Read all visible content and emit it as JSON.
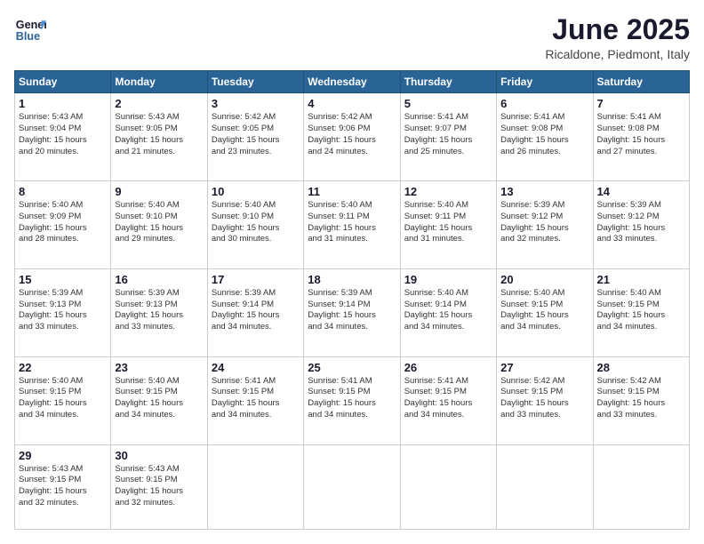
{
  "logo": {
    "line1": "General",
    "line2": "Blue"
  },
  "title": "June 2025",
  "location": "Ricaldone, Piedmont, Italy",
  "days_header": [
    "Sunday",
    "Monday",
    "Tuesday",
    "Wednesday",
    "Thursday",
    "Friday",
    "Saturday"
  ],
  "weeks": [
    [
      {
        "day": "1",
        "info": "Sunrise: 5:43 AM\nSunset: 9:04 PM\nDaylight: 15 hours\nand 20 minutes."
      },
      {
        "day": "2",
        "info": "Sunrise: 5:43 AM\nSunset: 9:05 PM\nDaylight: 15 hours\nand 21 minutes."
      },
      {
        "day": "3",
        "info": "Sunrise: 5:42 AM\nSunset: 9:05 PM\nDaylight: 15 hours\nand 23 minutes."
      },
      {
        "day": "4",
        "info": "Sunrise: 5:42 AM\nSunset: 9:06 PM\nDaylight: 15 hours\nand 24 minutes."
      },
      {
        "day": "5",
        "info": "Sunrise: 5:41 AM\nSunset: 9:07 PM\nDaylight: 15 hours\nand 25 minutes."
      },
      {
        "day": "6",
        "info": "Sunrise: 5:41 AM\nSunset: 9:08 PM\nDaylight: 15 hours\nand 26 minutes."
      },
      {
        "day": "7",
        "info": "Sunrise: 5:41 AM\nSunset: 9:08 PM\nDaylight: 15 hours\nand 27 minutes."
      }
    ],
    [
      {
        "day": "8",
        "info": "Sunrise: 5:40 AM\nSunset: 9:09 PM\nDaylight: 15 hours\nand 28 minutes."
      },
      {
        "day": "9",
        "info": "Sunrise: 5:40 AM\nSunset: 9:10 PM\nDaylight: 15 hours\nand 29 minutes."
      },
      {
        "day": "10",
        "info": "Sunrise: 5:40 AM\nSunset: 9:10 PM\nDaylight: 15 hours\nand 30 minutes."
      },
      {
        "day": "11",
        "info": "Sunrise: 5:40 AM\nSunset: 9:11 PM\nDaylight: 15 hours\nand 31 minutes."
      },
      {
        "day": "12",
        "info": "Sunrise: 5:40 AM\nSunset: 9:11 PM\nDaylight: 15 hours\nand 31 minutes."
      },
      {
        "day": "13",
        "info": "Sunrise: 5:39 AM\nSunset: 9:12 PM\nDaylight: 15 hours\nand 32 minutes."
      },
      {
        "day": "14",
        "info": "Sunrise: 5:39 AM\nSunset: 9:12 PM\nDaylight: 15 hours\nand 33 minutes."
      }
    ],
    [
      {
        "day": "15",
        "info": "Sunrise: 5:39 AM\nSunset: 9:13 PM\nDaylight: 15 hours\nand 33 minutes."
      },
      {
        "day": "16",
        "info": "Sunrise: 5:39 AM\nSunset: 9:13 PM\nDaylight: 15 hours\nand 33 minutes."
      },
      {
        "day": "17",
        "info": "Sunrise: 5:39 AM\nSunset: 9:14 PM\nDaylight: 15 hours\nand 34 minutes."
      },
      {
        "day": "18",
        "info": "Sunrise: 5:39 AM\nSunset: 9:14 PM\nDaylight: 15 hours\nand 34 minutes."
      },
      {
        "day": "19",
        "info": "Sunrise: 5:40 AM\nSunset: 9:14 PM\nDaylight: 15 hours\nand 34 minutes."
      },
      {
        "day": "20",
        "info": "Sunrise: 5:40 AM\nSunset: 9:15 PM\nDaylight: 15 hours\nand 34 minutes."
      },
      {
        "day": "21",
        "info": "Sunrise: 5:40 AM\nSunset: 9:15 PM\nDaylight: 15 hours\nand 34 minutes."
      }
    ],
    [
      {
        "day": "22",
        "info": "Sunrise: 5:40 AM\nSunset: 9:15 PM\nDaylight: 15 hours\nand 34 minutes."
      },
      {
        "day": "23",
        "info": "Sunrise: 5:40 AM\nSunset: 9:15 PM\nDaylight: 15 hours\nand 34 minutes."
      },
      {
        "day": "24",
        "info": "Sunrise: 5:41 AM\nSunset: 9:15 PM\nDaylight: 15 hours\nand 34 minutes."
      },
      {
        "day": "25",
        "info": "Sunrise: 5:41 AM\nSunset: 9:15 PM\nDaylight: 15 hours\nand 34 minutes."
      },
      {
        "day": "26",
        "info": "Sunrise: 5:41 AM\nSunset: 9:15 PM\nDaylight: 15 hours\nand 34 minutes."
      },
      {
        "day": "27",
        "info": "Sunrise: 5:42 AM\nSunset: 9:15 PM\nDaylight: 15 hours\nand 33 minutes."
      },
      {
        "day": "28",
        "info": "Sunrise: 5:42 AM\nSunset: 9:15 PM\nDaylight: 15 hours\nand 33 minutes."
      }
    ],
    [
      {
        "day": "29",
        "info": "Sunrise: 5:43 AM\nSunset: 9:15 PM\nDaylight: 15 hours\nand 32 minutes."
      },
      {
        "day": "30",
        "info": "Sunrise: 5:43 AM\nSunset: 9:15 PM\nDaylight: 15 hours\nand 32 minutes."
      },
      {
        "day": "",
        "info": ""
      },
      {
        "day": "",
        "info": ""
      },
      {
        "day": "",
        "info": ""
      },
      {
        "day": "",
        "info": ""
      },
      {
        "day": "",
        "info": ""
      }
    ]
  ]
}
